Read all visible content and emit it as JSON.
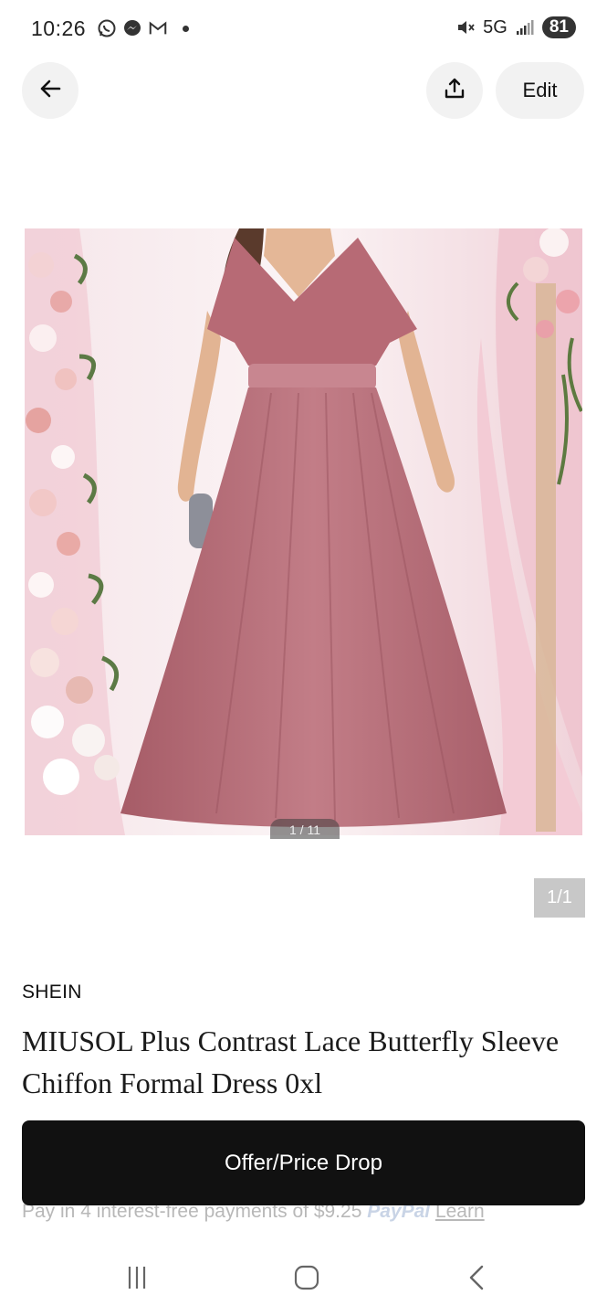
{
  "status_bar": {
    "time": "10:26",
    "network": "5G",
    "battery": "81"
  },
  "actions": {
    "edit_label": "Edit"
  },
  "image": {
    "counter_partial": "1 / 11",
    "page_badge": "1/1"
  },
  "product": {
    "brand": "SHEIN",
    "title": "MIUSOL Plus Contrast Lace Butterfly Sleeve Chiffon Formal Dress 0xl"
  },
  "payment": {
    "text": "Pay in 4 interest-free payments of $9.25",
    "provider": "PayPal",
    "learn": "Learn"
  },
  "buttons": {
    "offer": "Offer/Price Drop"
  },
  "icons": {
    "whatsapp": "whatsapp-icon",
    "messenger": "messenger-icon",
    "gmail": "gmail-icon",
    "mute": "mute-icon",
    "signal": "signal-icon",
    "back": "back-arrow-icon",
    "share": "share-icon",
    "recents": "recents-icon",
    "home": "home-icon",
    "nav_back": "nav-back-icon"
  },
  "colors": {
    "dress": "#b9707a",
    "offer_button": "#111111"
  }
}
